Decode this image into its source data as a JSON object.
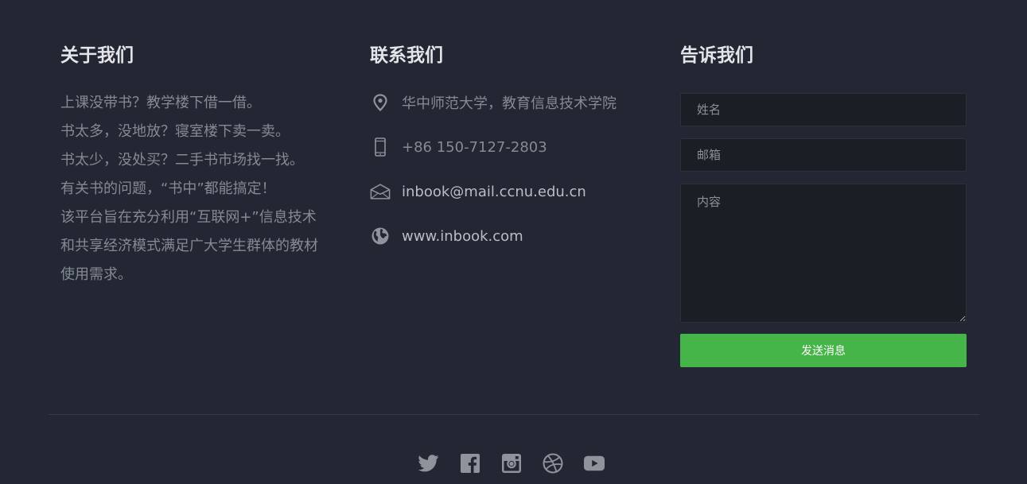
{
  "about": {
    "heading": "关于我们",
    "lines": [
      "上课没带书？教学楼下借一借。",
      "书太多，没地放？寝室楼下卖一卖。",
      "书太少，没处买？二手书市场找一找。",
      "有关书的问题，“书中”都能搞定！",
      "该平台旨在充分利用“互联网+”信息技术",
      "和共享经济模式满足广大学生群体的教材",
      "使用需求。"
    ]
  },
  "contact": {
    "heading": "联系我们",
    "items": [
      {
        "icon": "location-pin-icon",
        "text": "华中师范大学，教育信息技术学院"
      },
      {
        "icon": "phone-icon",
        "text": "+86 150-7127-2803"
      },
      {
        "icon": "envelope-icon",
        "text": "inbook@mail.ccnu.edu.cn"
      },
      {
        "icon": "globe-icon",
        "text": "www.inbook.com"
      }
    ]
  },
  "form": {
    "heading": "告诉我们",
    "name_placeholder": "姓名",
    "email_placeholder": "邮箱",
    "message_placeholder": "内容",
    "send_label": "发送消息"
  },
  "social": {
    "icons": [
      "twitter-icon",
      "facebook-icon",
      "instagram-icon",
      "dribbble-icon",
      "youtube-icon"
    ]
  },
  "colors": {
    "background": "#222733",
    "heading": "#e3e5e8",
    "text_muted": "#858a93",
    "field_bg": "#1b1e25",
    "accent_green": "#46b549",
    "icon": "#8f949c"
  }
}
